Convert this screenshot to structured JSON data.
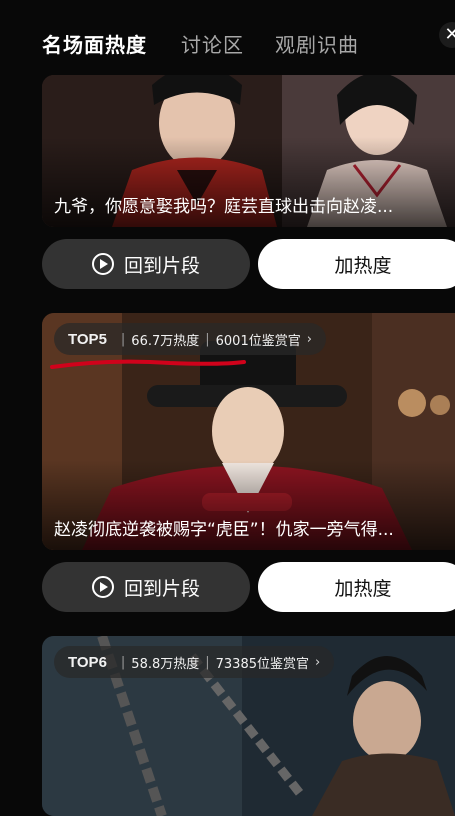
{
  "tabs": [
    {
      "label": "名场面热度",
      "active": true
    },
    {
      "label": "讨论区",
      "active": false
    },
    {
      "label": "观剧识曲",
      "active": false
    }
  ],
  "close_icon": "close-icon",
  "cards": [
    {
      "caption": "九爷，你愿意娶我吗？庭芸直球出击向赵凌...",
      "scene": "red-robed man and woman in pink",
      "replay_label": "回到片段",
      "heat_label": "加热度"
    },
    {
      "rank": "TOP5",
      "heat": "66.7万热度",
      "viewers": "6001位鉴赏官",
      "caption": "赵凌彻底逆袭被赐字“虎臣”！仇家一旁气得...",
      "scene": "official in red robe and black winged hat",
      "replay_label": "回到片段",
      "heat_label": "加热度"
    },
    {
      "rank": "TOP6",
      "heat": "58.8万热度",
      "viewers": "73385位鉴赏官",
      "scene": "chained prisoner in dark cell"
    }
  ],
  "colors": {
    "background": "#080808",
    "button_dark": "#333333",
    "button_light": "#ffffff",
    "annotation": "#d0021b"
  }
}
